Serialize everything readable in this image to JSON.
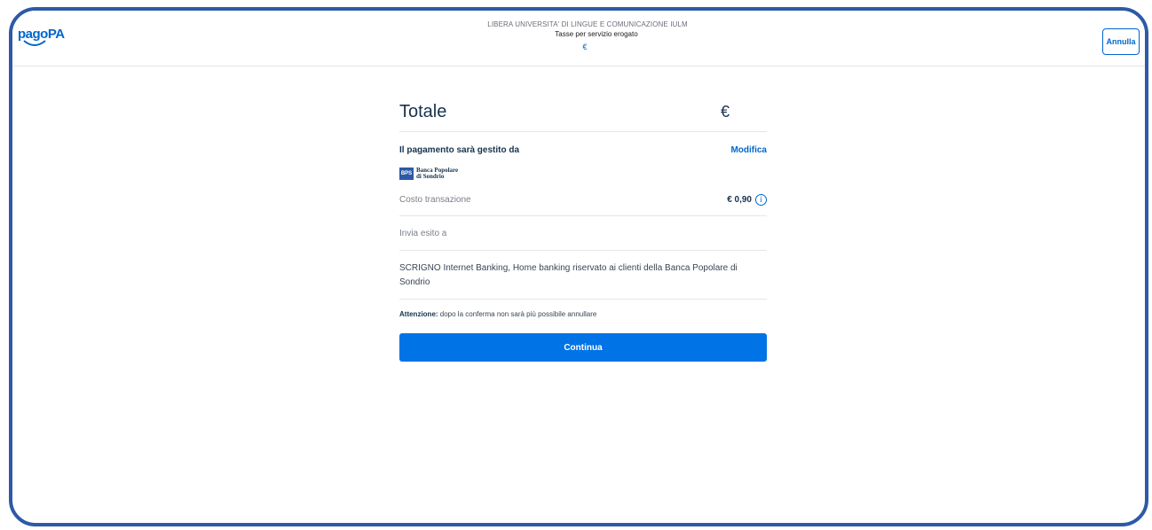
{
  "header": {
    "logo_text": "pagoPA",
    "organization": "LIBERA UNIVERSITA' DI LINGUE E COMUNICAZIONE IULM",
    "subject": "Tasse per servizio erogato",
    "amount": "€",
    "cancel_label": "Annulla"
  },
  "summary": {
    "total_label": "Totale",
    "total_value": "€",
    "psp_label": "Il pagamento sarà gestito da",
    "modify_label": "Modifica",
    "bank_mark": "BPS",
    "bank_name": "Banca Popolare\ndi Sondrio",
    "fee_label": "Costo transazione",
    "fee_value": "€ 0,90",
    "info_icon": "i",
    "send_result_label": "Invia esito a",
    "method_description": "SCRIGNO Internet Banking, Home banking riservato ai clienti della Banca Popolare di Sondrio",
    "warning_bold": "Attenzione:",
    "warning_text": " dopo la conferma non sarà più possibile annullare",
    "continue_label": "Continua"
  },
  "colors": {
    "frame_border": "#2d5aa6",
    "primary": "#0073e6",
    "link": "#0066cc",
    "text_dark": "#17324d"
  }
}
